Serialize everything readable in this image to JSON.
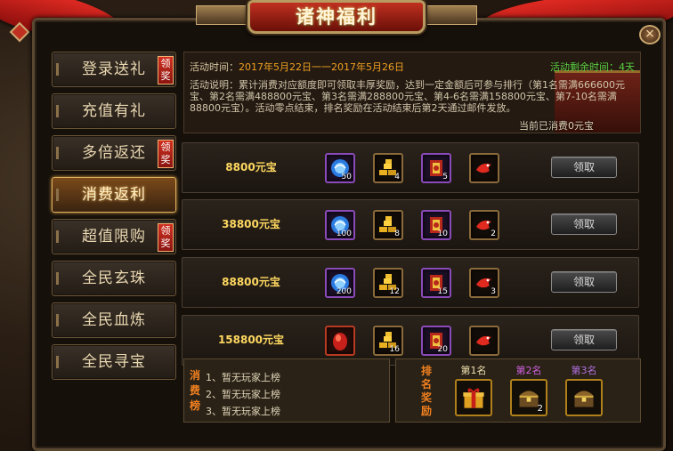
{
  "title": "诸神福利",
  "close_glyph": "×",
  "sidebar": {
    "items": [
      {
        "label": "登录送礼",
        "badge": "领奖",
        "active": false
      },
      {
        "label": "充值有礼",
        "badge": "",
        "active": false
      },
      {
        "label": "多倍返还",
        "badge": "领奖",
        "active": false
      },
      {
        "label": "消费返利",
        "badge": "",
        "active": true
      },
      {
        "label": "超值限购",
        "badge": "领奖",
        "active": false
      },
      {
        "label": "全民玄珠",
        "badge": "",
        "active": false
      },
      {
        "label": "全民血炼",
        "badge": "",
        "active": false
      },
      {
        "label": "全民寻宝",
        "badge": "",
        "active": false
      }
    ]
  },
  "info": {
    "time_label": "活动时间：",
    "time_value": "2017年5月22日一一2017年5月26日",
    "remaining": "活动剩余时间：4天",
    "description": "活动说明：累计消费对应额度即可领取丰厚奖励，达到一定金额后可参与排行（第1名需满666600元宝、第2名需满488800元宝、第3名需满288800元宝、第4-6名需满158800元宝、第7-10名需满88800元宝）。活动零点结束，排名奖励在活动结束后第2天通过邮件发放。",
    "current_spent": "当前已消费0元宝"
  },
  "rewards": [
    {
      "amount": "8800元宝",
      "items": [
        {
          "icon": "blue-orb-icon",
          "frame": "purple",
          "count": "50"
        },
        {
          "icon": "gold-bars-icon",
          "frame": "gold",
          "count": "4"
        },
        {
          "icon": "scroll-icon",
          "frame": "purple",
          "count": "5"
        },
        {
          "icon": "red-bird-icon",
          "frame": "gold",
          "count": ""
        }
      ],
      "button": "领取"
    },
    {
      "amount": "38800元宝",
      "items": [
        {
          "icon": "blue-orb-icon",
          "frame": "purple",
          "count": "100"
        },
        {
          "icon": "gold-bars-icon",
          "frame": "gold",
          "count": "8"
        },
        {
          "icon": "scroll-icon",
          "frame": "purple",
          "count": "10"
        },
        {
          "icon": "red-bird-icon",
          "frame": "gold",
          "count": "2"
        }
      ],
      "button": "领取"
    },
    {
      "amount": "88800元宝",
      "items": [
        {
          "icon": "blue-orb-icon",
          "frame": "purple",
          "count": "200"
        },
        {
          "icon": "gold-bars-icon",
          "frame": "gold",
          "count": "12"
        },
        {
          "icon": "scroll-icon",
          "frame": "purple",
          "count": "15"
        },
        {
          "icon": "red-bird-icon",
          "frame": "gold",
          "count": "3"
        }
      ],
      "button": "领取"
    },
    {
      "amount": "158800元宝",
      "items": [
        {
          "icon": "red-egg-icon",
          "frame": "red",
          "count": ""
        },
        {
          "icon": "gold-bars-icon",
          "frame": "gold",
          "count": "16"
        },
        {
          "icon": "scroll-icon",
          "frame": "purple",
          "count": "20"
        },
        {
          "icon": "red-bird-icon",
          "frame": "gold",
          "count": ""
        }
      ],
      "button": "领取"
    }
  ],
  "ranking": {
    "title": "消费榜",
    "entries": [
      "1、暂无玩家上榜",
      "2、暂无玩家上榜",
      "3、暂无玩家上榜"
    ]
  },
  "rank_rewards": {
    "title": "排名奖励",
    "places": [
      {
        "label": "第1名",
        "color": "#f0e0b0",
        "icon": "gift-box-icon",
        "count": ""
      },
      {
        "label": "第2名",
        "color": "#d060e0",
        "icon": "treasure-chest-icon",
        "count": "2"
      },
      {
        "label": "第3名",
        "color": "#b070e0",
        "icon": "treasure-chest-icon",
        "count": ""
      }
    ]
  }
}
